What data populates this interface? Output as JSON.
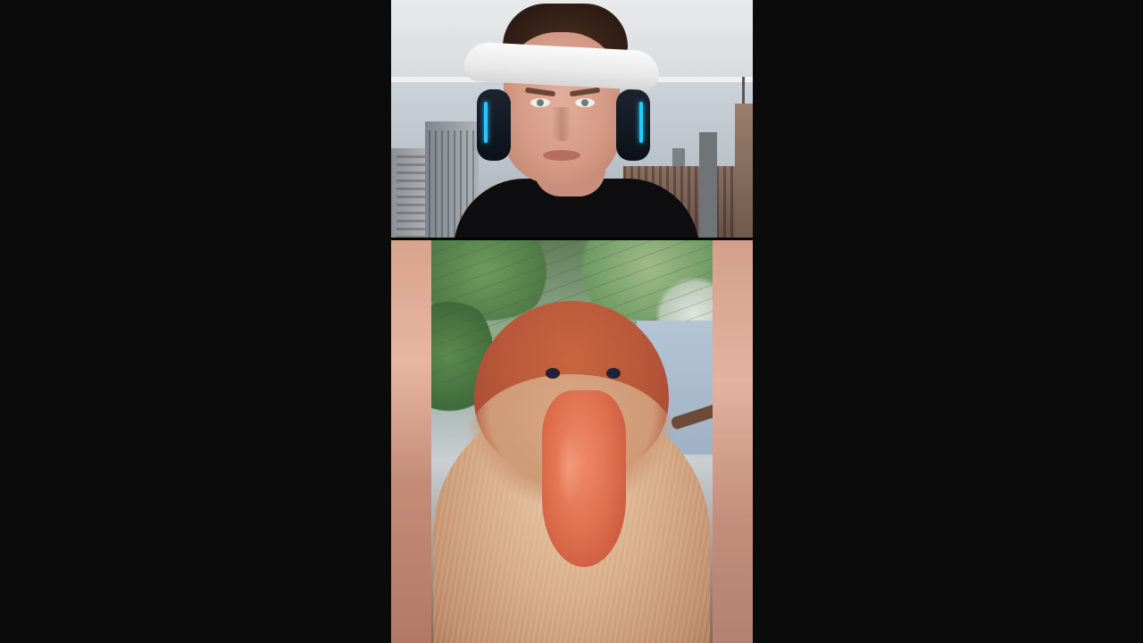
{
  "video": {
    "top_panel": {
      "subject": "person-with-headband-and-headset"
    },
    "bottom_panel": {
      "subject": "proboscis-monkey"
    }
  },
  "colors": {
    "letterbox": "#0b0b0b",
    "headset_accent": "#27c8ff",
    "monkey_nose": "#de6f4e"
  }
}
